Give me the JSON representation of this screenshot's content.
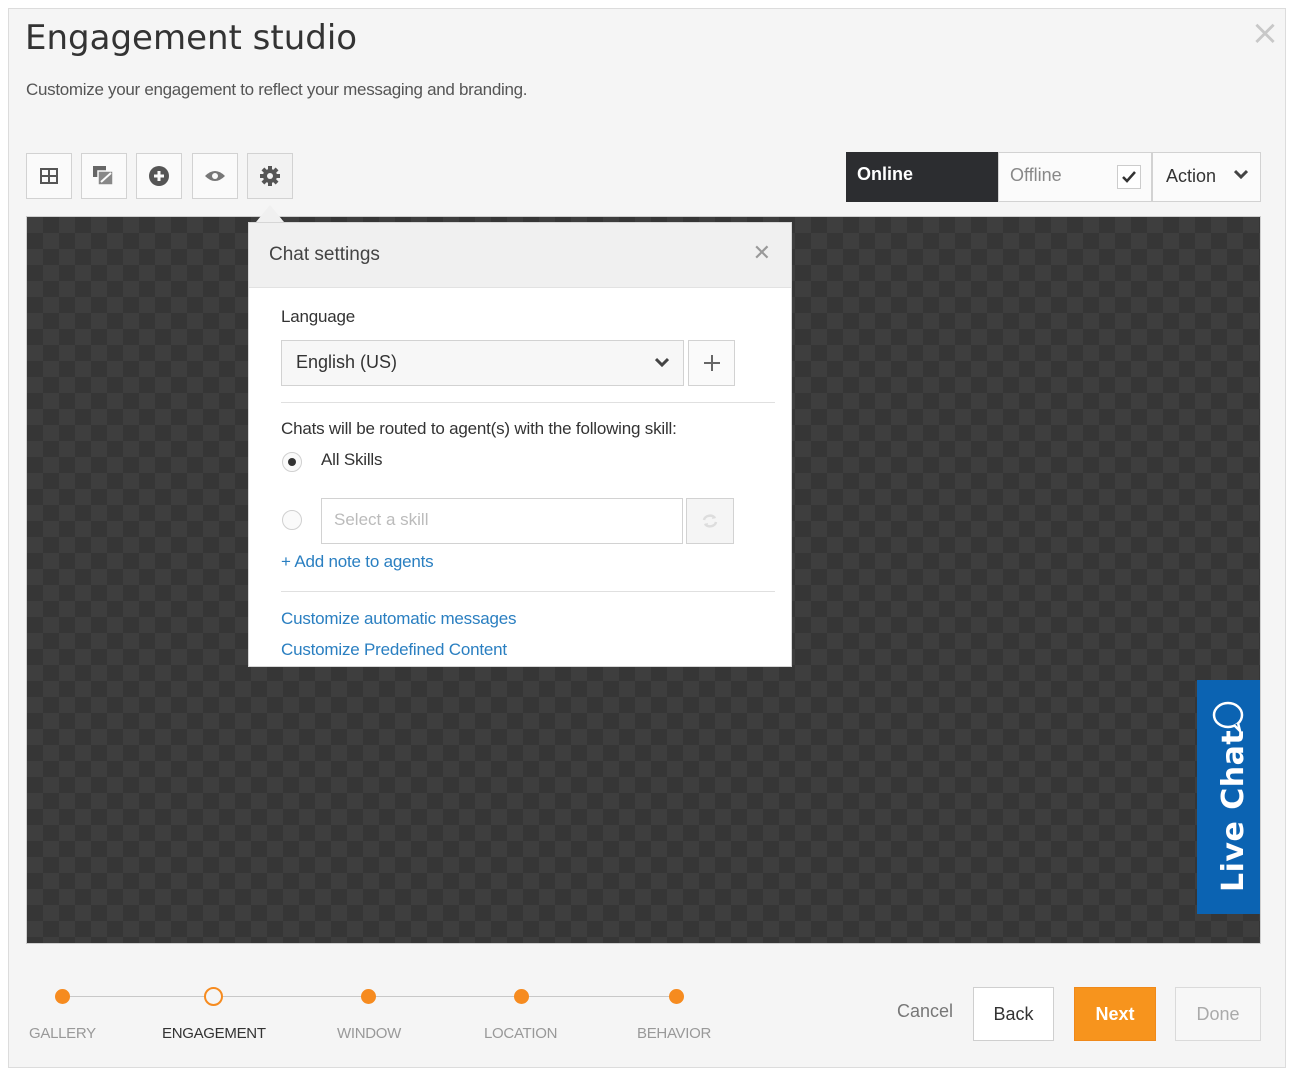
{
  "header": {
    "title": "Engagement studio",
    "subtitle": "Customize your engagement to reflect your messaging and branding.",
    "close_icon": "close-icon"
  },
  "toolbar": {
    "tools": [
      {
        "name": "layout-icon"
      },
      {
        "name": "image-edit-icon"
      },
      {
        "name": "add-icon"
      },
      {
        "name": "preview-eye-icon"
      },
      {
        "name": "settings-gear-icon"
      }
    ],
    "status": {
      "online_label": "Online",
      "offline_label": "Offline",
      "offline_checked": true
    },
    "action_label": "Action"
  },
  "preview": {
    "live_chat_label": "Live Chat",
    "live_chat_color": "#0b63b2"
  },
  "chat_settings": {
    "title": "Chat settings",
    "language_label": "Language",
    "language_value": "English (US)",
    "routing_label": "Chats will be routed to agent(s) with the following skill:",
    "all_skills_label": "All Skills",
    "all_skills_selected": true,
    "skill_placeholder": "Select a skill",
    "add_note_link": "+ Add note to agents",
    "customize_auto_link": "Customize automatic messages",
    "customize_predefined_link": "Customize Predefined Content"
  },
  "wizard": {
    "steps": [
      {
        "label": "GALLERY",
        "state": "done"
      },
      {
        "label": "ENGAGEMENT",
        "state": "current"
      },
      {
        "label": "WINDOW",
        "state": "done"
      },
      {
        "label": "LOCATION",
        "state": "done"
      },
      {
        "label": "BEHAVIOR",
        "state": "done"
      }
    ],
    "accent_color": "#f68b1f",
    "cancel_label": "Cancel",
    "back_label": "Back",
    "next_label": "Next",
    "done_label": "Done"
  }
}
